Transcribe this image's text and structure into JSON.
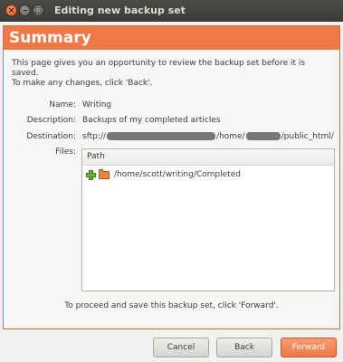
{
  "window": {
    "title": "Editing new backup set",
    "controls": {
      "close": "×",
      "minimize": "–",
      "maximize": "□"
    }
  },
  "header": {
    "title": "Summary"
  },
  "intro": {
    "line1": "This page gives you an opportunity to review the backup set before it is saved.",
    "line2": "To make any changes, click 'Back'."
  },
  "details": {
    "name_label": "Name:",
    "name_value": "Writing",
    "description_label": "Description:",
    "description_value": "Backups of my completed articles",
    "destination_label": "Destination:",
    "destination_prefix": "sftp://",
    "destination_middle": "/home/",
    "destination_suffix": "/public_html/",
    "files_label": "Files:"
  },
  "files": {
    "column_header": "Path",
    "items": [
      {
        "path": "/home/scott/writing/Completed",
        "status_icon": "plus-icon",
        "type_icon": "folder-icon"
      }
    ]
  },
  "footer": {
    "proceed_text": "To proceed and save this backup set, click 'Forward'."
  },
  "buttons": {
    "cancel": "Cancel",
    "back": "Back",
    "forward": "Forward"
  },
  "colors": {
    "accent": "#f07746",
    "titlebar": "#3c3b37"
  }
}
